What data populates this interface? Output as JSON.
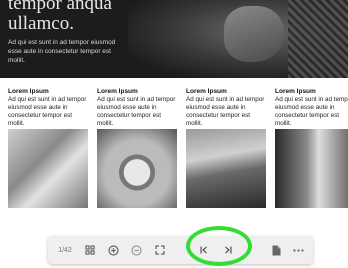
{
  "hero": {
    "title_line1": "tempor anqua",
    "title_line2": "ullamco.",
    "text": "Ad qui est sunt in ad tempor eiusmod esse aute in consectetur tempor est mollit."
  },
  "cards": [
    {
      "heading": "Lorem Ipsum",
      "text": "Ad qui est sunt in ad tempor eiusmod esse aute in consectetur tempor est mollit."
    },
    {
      "heading": "Lorem Ipsum",
      "text": "Ad qui est sunt in ad tempor eiusmod esse aute in consectetur tempor est mollit."
    },
    {
      "heading": "Lorem Ipsum",
      "text": "Ad qui est sunt in ad tempor eiusmod esse aute in consectetur tempor est mollit."
    },
    {
      "heading": "Lorem Ipsum",
      "text": "Ad qui est sunt in ad tempor eiusmod esse aute in consectetur tempor est mollit."
    }
  ],
  "toolbar": {
    "page_indicator": "1/42",
    "icons": [
      "grid-icon",
      "zoom-in-icon",
      "zoom-out-icon",
      "fullscreen-icon",
      "first-page-icon",
      "last-page-icon",
      "document-icon",
      "more-icon"
    ]
  },
  "colors": {
    "highlight": "#33dd33",
    "toolbar_bg": "#efefef"
  }
}
